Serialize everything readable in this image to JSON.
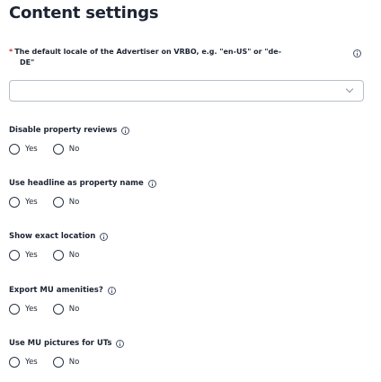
{
  "title": "Content settings",
  "locale": {
    "required_mark": "*",
    "label_line1": "The default locale of the Advertiser on VRBO, e.g. \"en-US\" or \"de-",
    "label_line2": "DE\"",
    "value": "",
    "info_icon": "info-icon",
    "dropdown_icon": "chevron-down-icon"
  },
  "questions": [
    {
      "label": "Disable property reviews",
      "options": [
        "Yes",
        "No"
      ],
      "selected": null
    },
    {
      "label": "Use headline as property name",
      "options": [
        "Yes",
        "No"
      ],
      "selected": null
    },
    {
      "label": "Show exact location",
      "options": [
        "Yes",
        "No"
      ],
      "selected": null
    },
    {
      "label": "Export MU amenities?",
      "options": [
        "Yes",
        "No"
      ],
      "selected": null
    },
    {
      "label": "Use MU pictures for UTs",
      "options": [
        "Yes",
        "No"
      ],
      "selected": null
    }
  ]
}
